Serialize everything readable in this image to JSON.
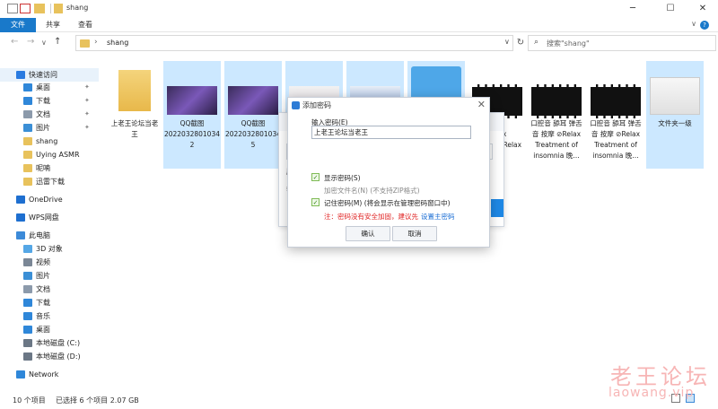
{
  "window": {
    "title": "shang",
    "min": "─",
    "max": "☐",
    "close": "✕"
  },
  "ribbon": {
    "tabs": [
      "文件",
      "共享",
      "查看"
    ],
    "collapse": "∨",
    "help": "?"
  },
  "address": {
    "path": "shang",
    "chevron": "›",
    "dropdown": "∨",
    "refresh": "↻"
  },
  "search": {
    "placeholder": "搜索\"shang\"",
    "icon": "⌕"
  },
  "nav": {
    "back": "←",
    "forward": "→",
    "recent": "∨",
    "up": "↑"
  },
  "sidebar": {
    "items": [
      {
        "label": "快速访问",
        "icon": "star-icon",
        "color": "#2a7be0"
      },
      {
        "label": "桌面",
        "icon": "desktop-icon",
        "color": "#2f87d9",
        "pinned": true
      },
      {
        "label": "下载",
        "icon": "download-icon",
        "color": "#2f87d9",
        "pinned": true
      },
      {
        "label": "文档",
        "icon": "document-icon",
        "color": "#8c9aab",
        "pinned": true
      },
      {
        "label": "图片",
        "icon": "picture-icon",
        "color": "#3b8fd6",
        "pinned": true
      },
      {
        "label": "shang",
        "icon": "folder-icon",
        "color": "#e8c25c"
      },
      {
        "label": "Uying ASMR",
        "icon": "folder-icon",
        "color": "#e8c25c"
      },
      {
        "label": "呢喃",
        "icon": "folder-icon",
        "color": "#e8c25c"
      },
      {
        "label": "迅雷下载",
        "icon": "folder-icon",
        "color": "#e8c25c"
      },
      {
        "label": "OneDrive",
        "icon": "cloud-icon",
        "color": "#1e6fd0"
      },
      {
        "label": "WPS网盘",
        "icon": "cloud-icon",
        "color": "#1e6fd0"
      },
      {
        "label": "此电脑",
        "icon": "computer-icon",
        "color": "#3c8ad8"
      },
      {
        "label": "3D 对象",
        "icon": "cube-icon",
        "color": "#55a7e6"
      },
      {
        "label": "视频",
        "icon": "video-icon",
        "color": "#7b8796"
      },
      {
        "label": "图片",
        "icon": "picture-icon",
        "color": "#3b8fd6"
      },
      {
        "label": "文档",
        "icon": "document-icon",
        "color": "#8c9aab"
      },
      {
        "label": "下载",
        "icon": "download-icon",
        "color": "#2f87d9"
      },
      {
        "label": "音乐",
        "icon": "music-icon",
        "color": "#2f87d9"
      },
      {
        "label": "桌面",
        "icon": "desktop-icon",
        "color": "#2f87d9"
      },
      {
        "label": "本地磁盘 (C:)",
        "icon": "drive-icon",
        "color": "#6b7785"
      },
      {
        "label": "本地磁盘 (D:)",
        "icon": "drive-icon",
        "color": "#6b7785"
      },
      {
        "label": "Network",
        "icon": "network-icon",
        "color": "#2f87d9"
      }
    ],
    "pin_glyph": "✦"
  },
  "files": [
    {
      "name": "上老王论坛当老\n王",
      "kind": "folder",
      "selected": false
    },
    {
      "name": "QQ截图\n2022032801034\n2",
      "kind": "image",
      "selected": true
    },
    {
      "name": "QQ截图\n2022032801034\n5",
      "kind": "image",
      "selected": true
    },
    {
      "name": "",
      "kind": "image-light",
      "selected": true
    },
    {
      "name": "",
      "kind": "image-blue",
      "selected": true
    },
    {
      "name": "",
      "kind": "zip",
      "selected": true
    },
    {
      "name": "弹舌\nRelax\n音 按摩 ⊘Relax\n晚…",
      "kind": "video",
      "selected": false
    },
    {
      "name": "口腔音 舔耳 弹舌\n音 按摩 ⊘Relax\nTreatment of\ninsomnia  晚…",
      "kind": "video",
      "selected": false
    },
    {
      "name": "口腔音 舔耳 弹舌\n音 按摩 ⊘Relax\nTreatment of\ninsomnia  晚…",
      "kind": "video",
      "selected": false
    },
    {
      "name": "文件夹一级",
      "kind": "folder-doc",
      "selected": true
    }
  ],
  "status": {
    "count": "10 个项目",
    "selected": "已选择 6 个项目  2.07 GB"
  },
  "back_dialog": {
    "search_hint": "s",
    "label_1": "压",
    "label_2": "输"
  },
  "dialog": {
    "title": "添加密码",
    "close": "✕",
    "password_label": "输入密码(E)",
    "password_value": "上老王论坛当老王",
    "show_password": "显示密码(S)",
    "encrypt_names": "加密文件名(N) (不支持ZIP格式)",
    "remember": "记住密码(M) (将会显示在管理密码窗口中)",
    "warning": "注：密码没有安全加固，建议先",
    "warning_link": "设置主密码",
    "ok": "确认",
    "cancel": "取消",
    "check": "✓"
  },
  "watermark": {
    "line1": "老王论坛",
    "line2": "laowang.vip"
  }
}
